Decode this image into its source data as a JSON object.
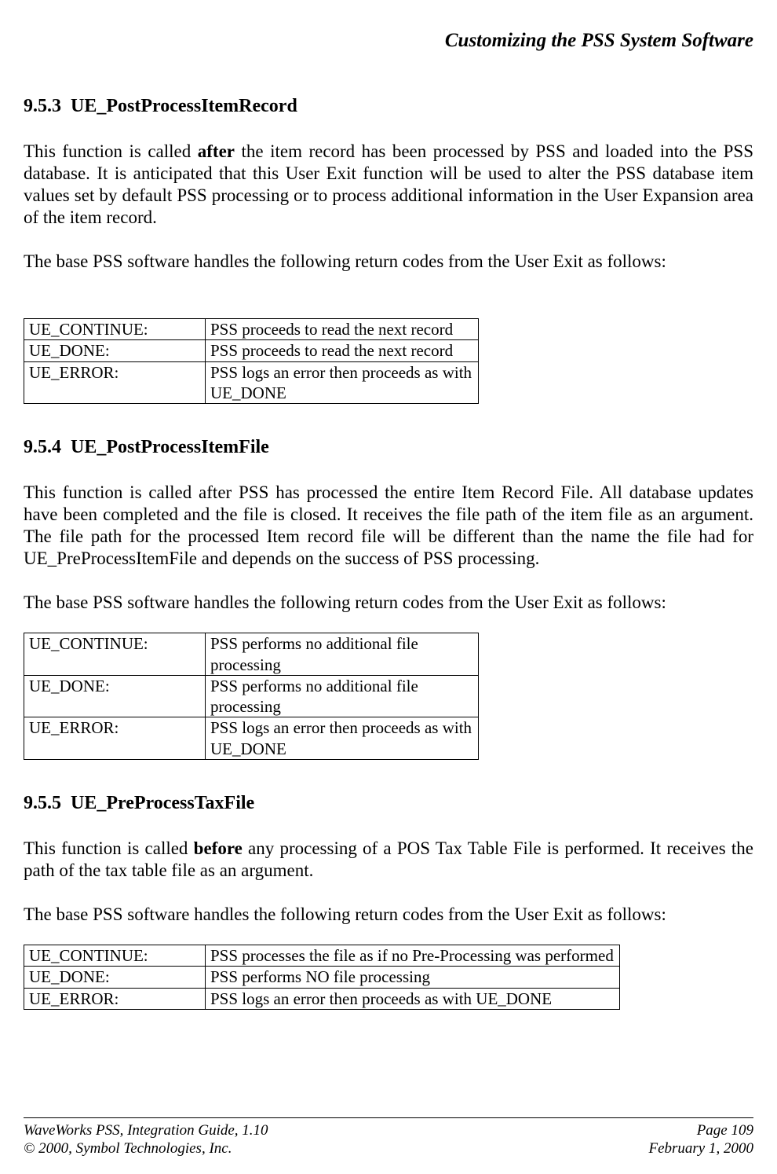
{
  "header": {
    "title": "Customizing the PSS System Software"
  },
  "sections": [
    {
      "number": "9.5.3",
      "title": "UE_PostProcessItemRecord",
      "para1_pre": "This function is called ",
      "para1_bold": "after",
      "para1_post": " the item record has been processed by PSS and loaded into the PSS database.  It is anticipated that this User Exit function will be used to alter the PSS database item values set by default PSS processing or to process additional information in the User Expansion area of the item record.",
      "para2": "The base PSS software handles the following return codes from the User Exit as follows:",
      "table": [
        {
          "code": "UE_CONTINUE:",
          "desc": "PSS proceeds to read the next record"
        },
        {
          "code": "UE_DONE:",
          "desc": "PSS proceeds to read the next record"
        },
        {
          "code": "UE_ERROR:",
          "desc": "PSS logs an error then proceeds as with UE_DONE"
        }
      ],
      "wide": false,
      "big_gap": true
    },
    {
      "number": "9.5.4",
      "title": "UE_PostProcessItemFile",
      "para1_pre": "",
      "para1_bold": "",
      "para1_post": "This function is called after PSS has processed the entire Item Record File.  All database updates have been completed and the file is closed.  It receives the file path of the item file as an argument.  The file path for the processed Item record file will be different than the name the file had for UE_PreProcessItemFile and depends on the success of PSS processing.",
      "para2": "The base PSS software handles the following return codes from the User Exit as follows:",
      "table": [
        {
          "code": "UE_CONTINUE:",
          "desc": "PSS performs no additional file processing"
        },
        {
          "code": "UE_DONE:",
          "desc": "PSS performs no additional file processing"
        },
        {
          "code": "UE_ERROR:",
          "desc": "PSS logs an error then proceeds as with UE_DONE"
        }
      ],
      "wide": false,
      "big_gap": false
    },
    {
      "number": "9.5.5",
      "title": "UE_PreProcessTaxFile",
      "para1_pre": "This function is called ",
      "para1_bold": "before",
      "para1_post": " any processing of a POS Tax Table File is performed.  It receives the path of the tax table file as an argument.",
      "para2": "The base PSS software handles the following return codes from the User Exit as follows:",
      "table": [
        {
          "code": "UE_CONTINUE:",
          "desc": "PSS processes the file as if no Pre-Processing was performed"
        },
        {
          "code": "UE_DONE:",
          "desc": "PSS performs NO file processing"
        },
        {
          "code": "UE_ERROR:",
          "desc": "PSS logs an error then proceeds as with UE_DONE"
        }
      ],
      "wide": true,
      "big_gap": false
    }
  ],
  "footer": {
    "left1": "WaveWorks PSS, Integration Guide, 1.10",
    "left2": "© 2000, Symbol Technologies, Inc.",
    "right1": "Page 109",
    "right2": "February 1, 2000"
  }
}
